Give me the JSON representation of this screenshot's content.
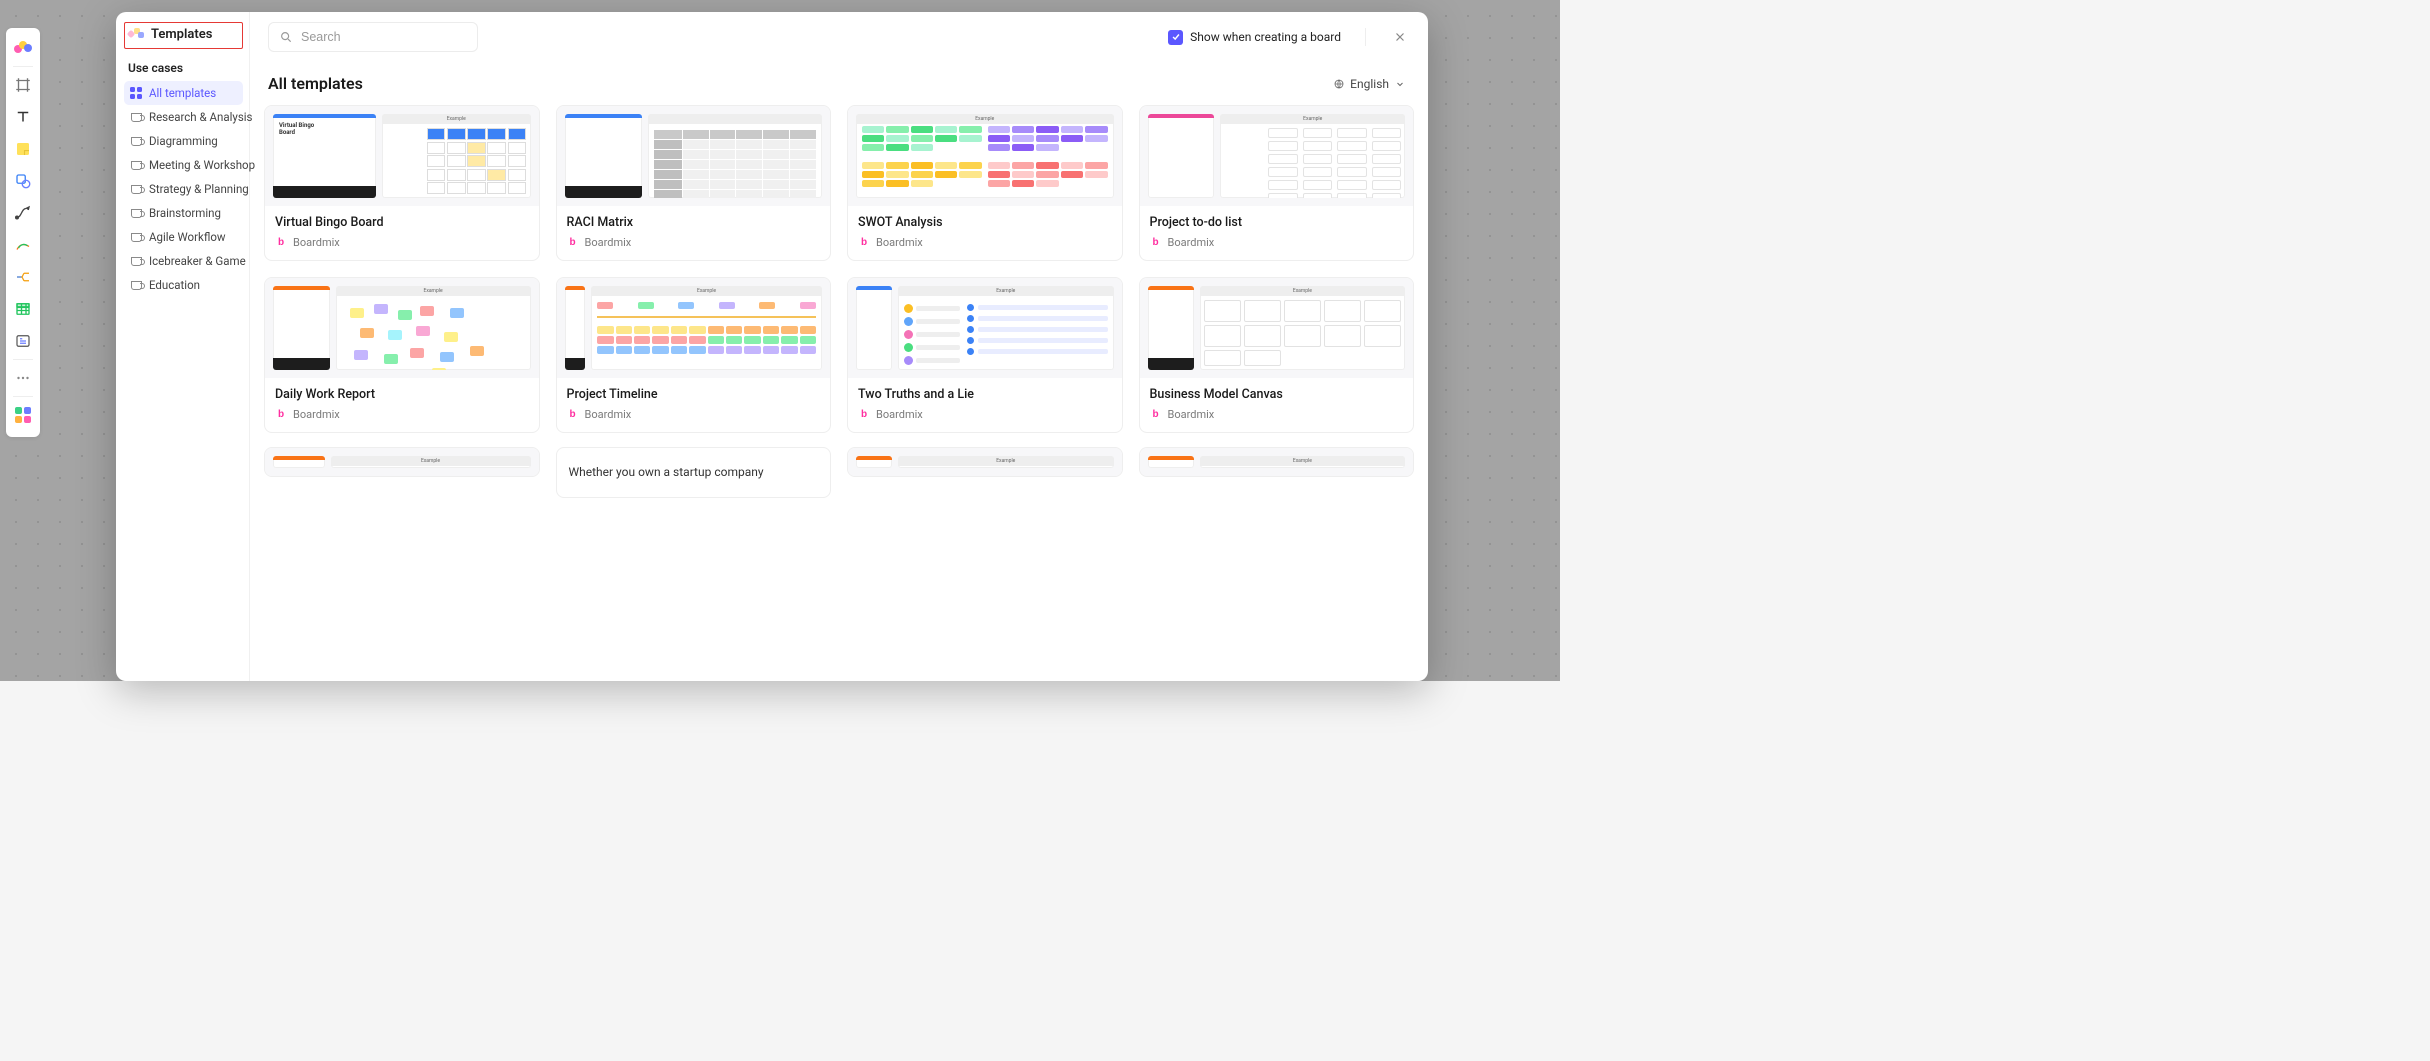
{
  "toolbar_tools": [
    "logo",
    "frame",
    "text",
    "sticky",
    "shape",
    "curve",
    "pen",
    "mindmap",
    "table",
    "text-block",
    "more",
    "apps"
  ],
  "modal": {
    "title": "Templates",
    "section_label": "Use cases",
    "categories": [
      {
        "id": "all",
        "label": "All templates",
        "active": true,
        "icon": "grid"
      },
      {
        "id": "research",
        "label": "Research & Analysis",
        "icon": "mug"
      },
      {
        "id": "diagram",
        "label": "Diagramming",
        "icon": "mug"
      },
      {
        "id": "meeting",
        "label": "Meeting & Workshop",
        "icon": "mug"
      },
      {
        "id": "strategy",
        "label": "Strategy & Planning",
        "icon": "mug"
      },
      {
        "id": "brainstorm",
        "label": "Brainstorming",
        "icon": "mug"
      },
      {
        "id": "agile",
        "label": "Agile Workflow",
        "icon": "mug"
      },
      {
        "id": "icebreaker",
        "label": "Icebreaker & Game",
        "icon": "mug"
      },
      {
        "id": "education",
        "label": "Education",
        "icon": "mug"
      }
    ],
    "search_placeholder": "Search",
    "show_checkbox_label": "Show when creating a board",
    "heading": "All templates",
    "language": "English",
    "author": "Boardmix",
    "cards": [
      {
        "title": "Virtual Bingo Board",
        "thumb": "bingo"
      },
      {
        "title": "RACI Matrix",
        "thumb": "raci"
      },
      {
        "title": "SWOT Analysis",
        "thumb": "swot"
      },
      {
        "title": "Project to-do list",
        "thumb": "todo"
      },
      {
        "title": "Daily Work Report",
        "thumb": "report"
      },
      {
        "title": "Project Timeline",
        "thumb": "timeline"
      },
      {
        "title": "Two Truths and a Lie",
        "thumb": "twotruths"
      },
      {
        "title": "Business Model Canvas",
        "thumb": "bmc"
      }
    ],
    "partial_cards": [
      {
        "thumb": "p1"
      },
      {
        "text": "Whether you own a startup company"
      },
      {
        "thumb": "p3"
      },
      {
        "thumb": "p4"
      }
    ]
  }
}
